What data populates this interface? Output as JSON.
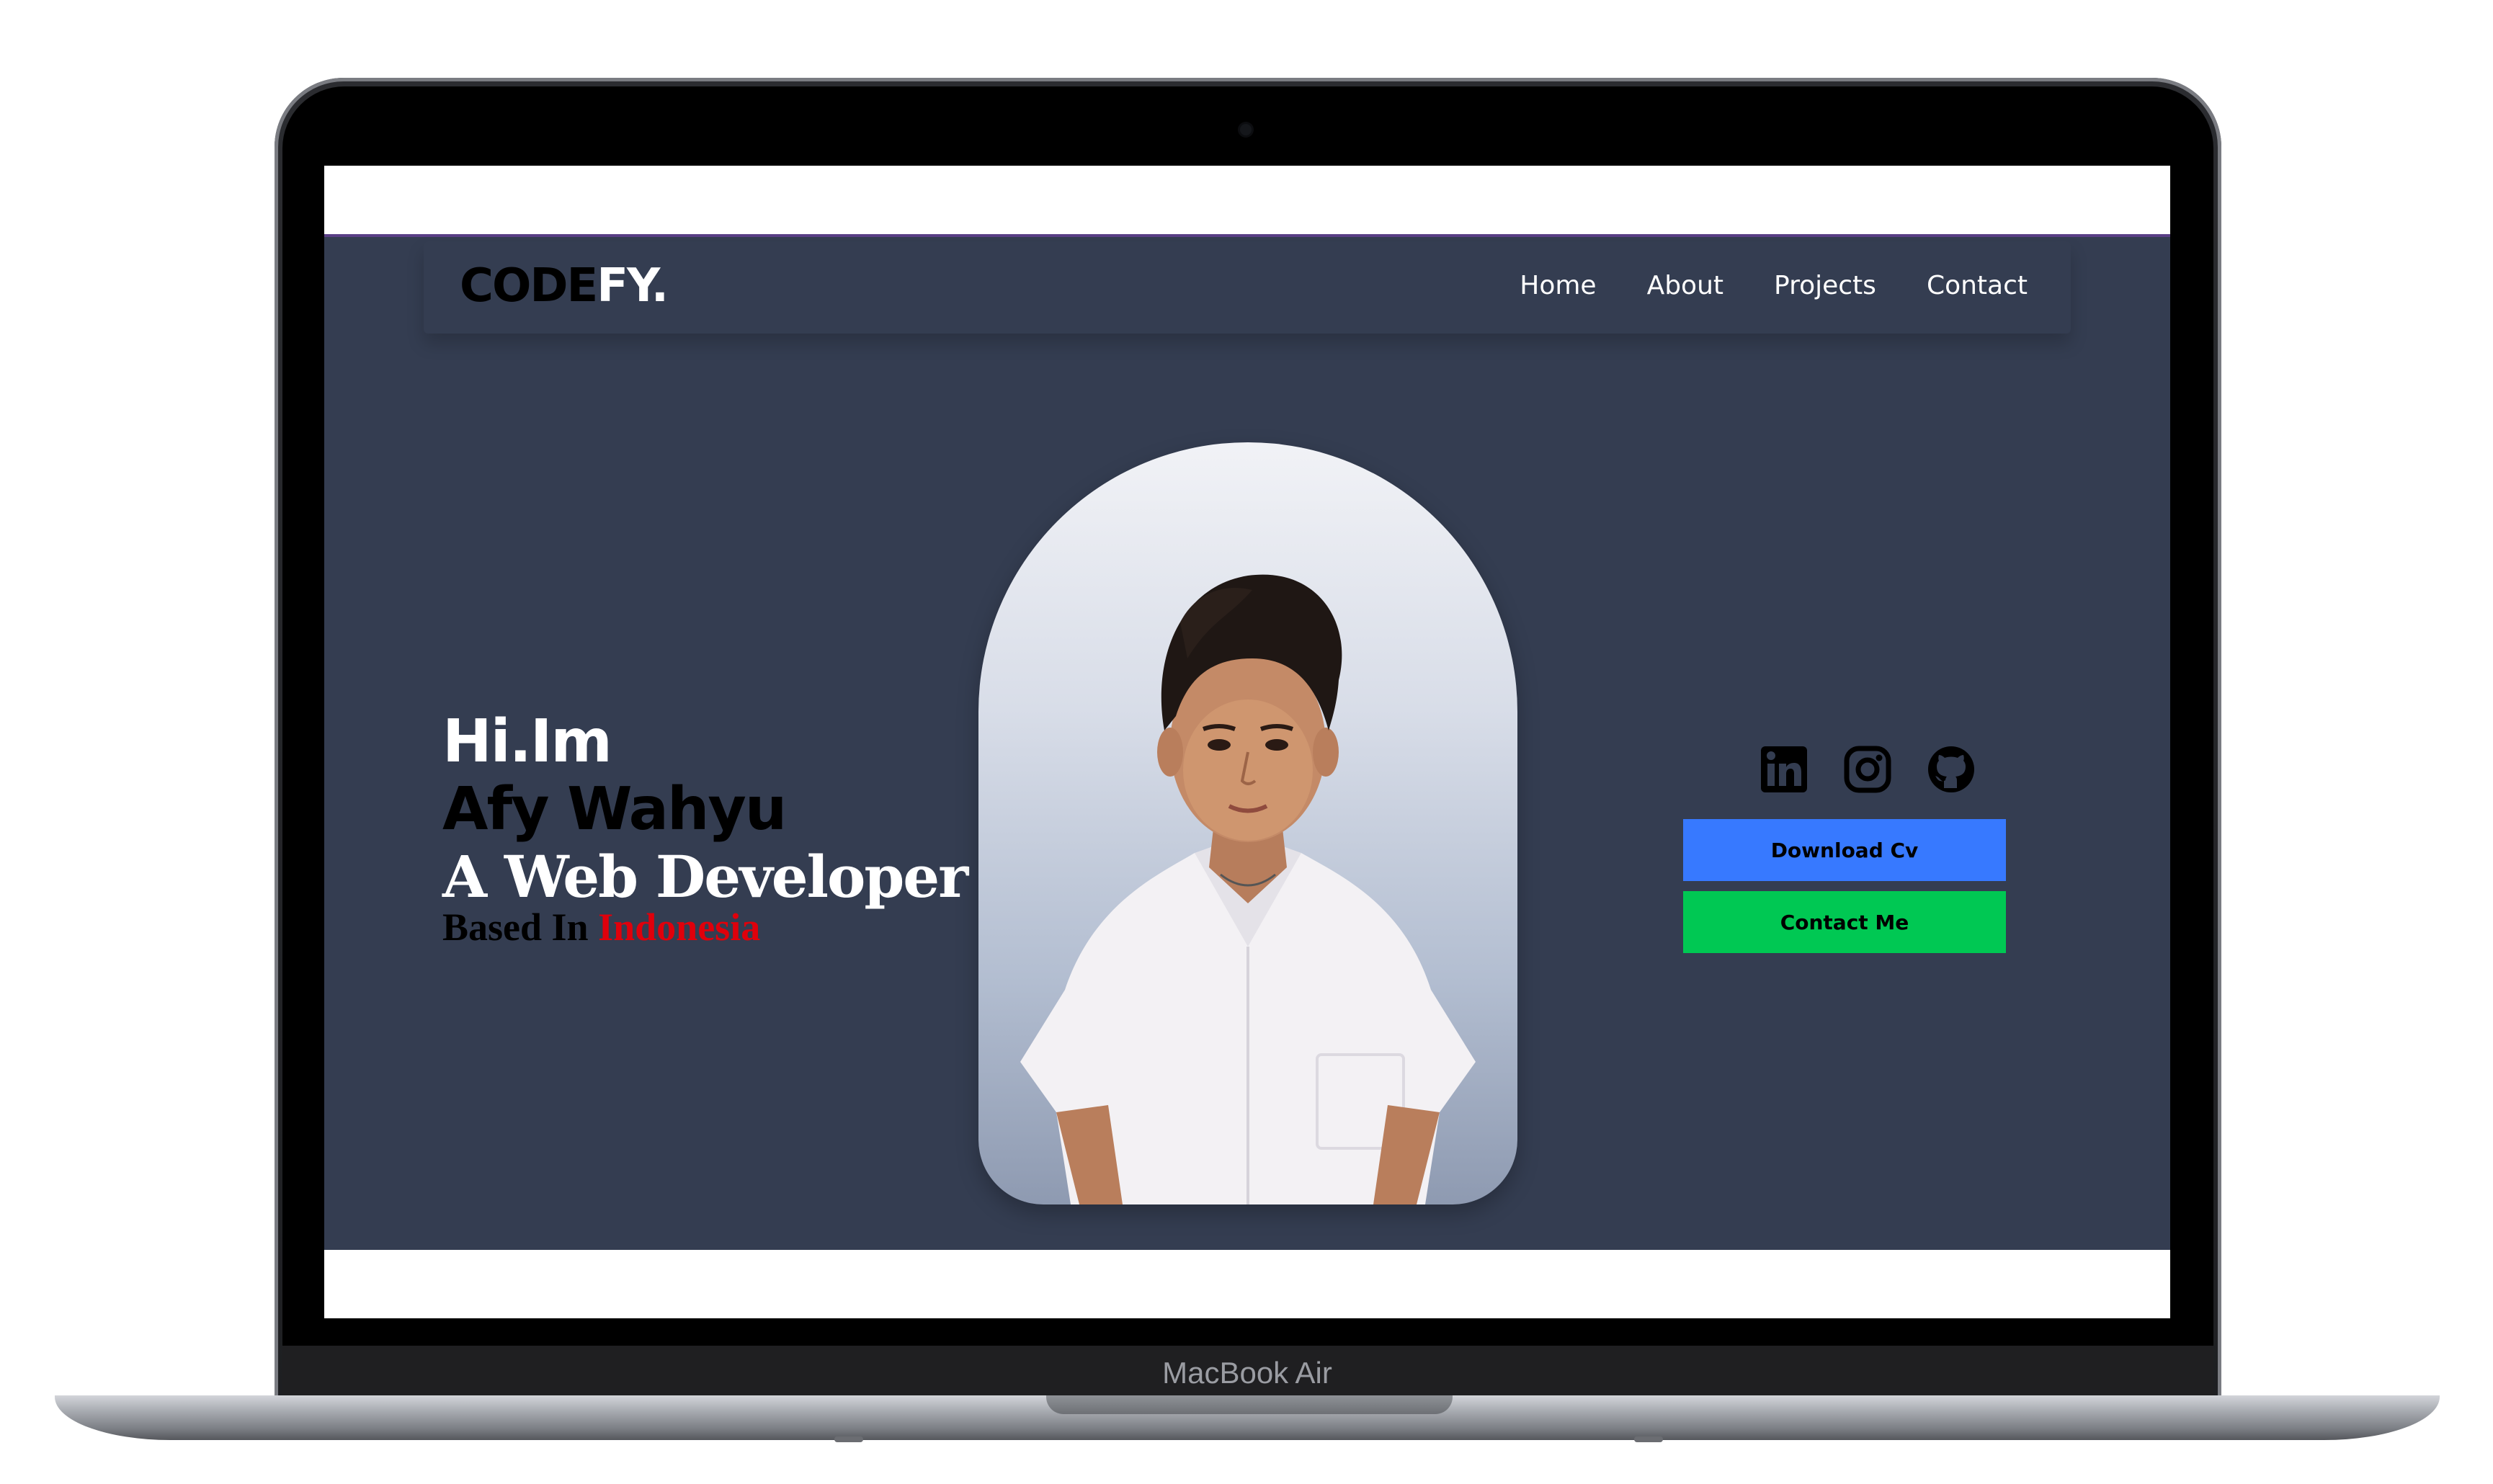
{
  "device": {
    "model_label": "MacBook Air"
  },
  "site": {
    "logo": {
      "part1": "CODE",
      "part2": "FY."
    },
    "nav": {
      "items": [
        {
          "label": "Home"
        },
        {
          "label": "About"
        },
        {
          "label": "Projects"
        },
        {
          "label": "Contact"
        }
      ]
    },
    "hero": {
      "greeting": "Hi.Im",
      "name": "Afy Wahyu",
      "role": "A Web Developer",
      "location_prefix": "Based In",
      "location_country": "Indonesia"
    },
    "socials": [
      {
        "icon": "linkedin-icon"
      },
      {
        "icon": "instagram-icon"
      },
      {
        "icon": "github-icon"
      }
    ],
    "buttons": {
      "download_cv": "Download Cv",
      "contact_me": "Contact Me"
    }
  },
  "colors": {
    "background": "#343d51",
    "accent_border": "#5a3f86",
    "download_button": "#3779ff",
    "contact_button": "#00c853",
    "highlight_text": "#e0000b"
  },
  "icons": {
    "portrait": "person-photo"
  }
}
